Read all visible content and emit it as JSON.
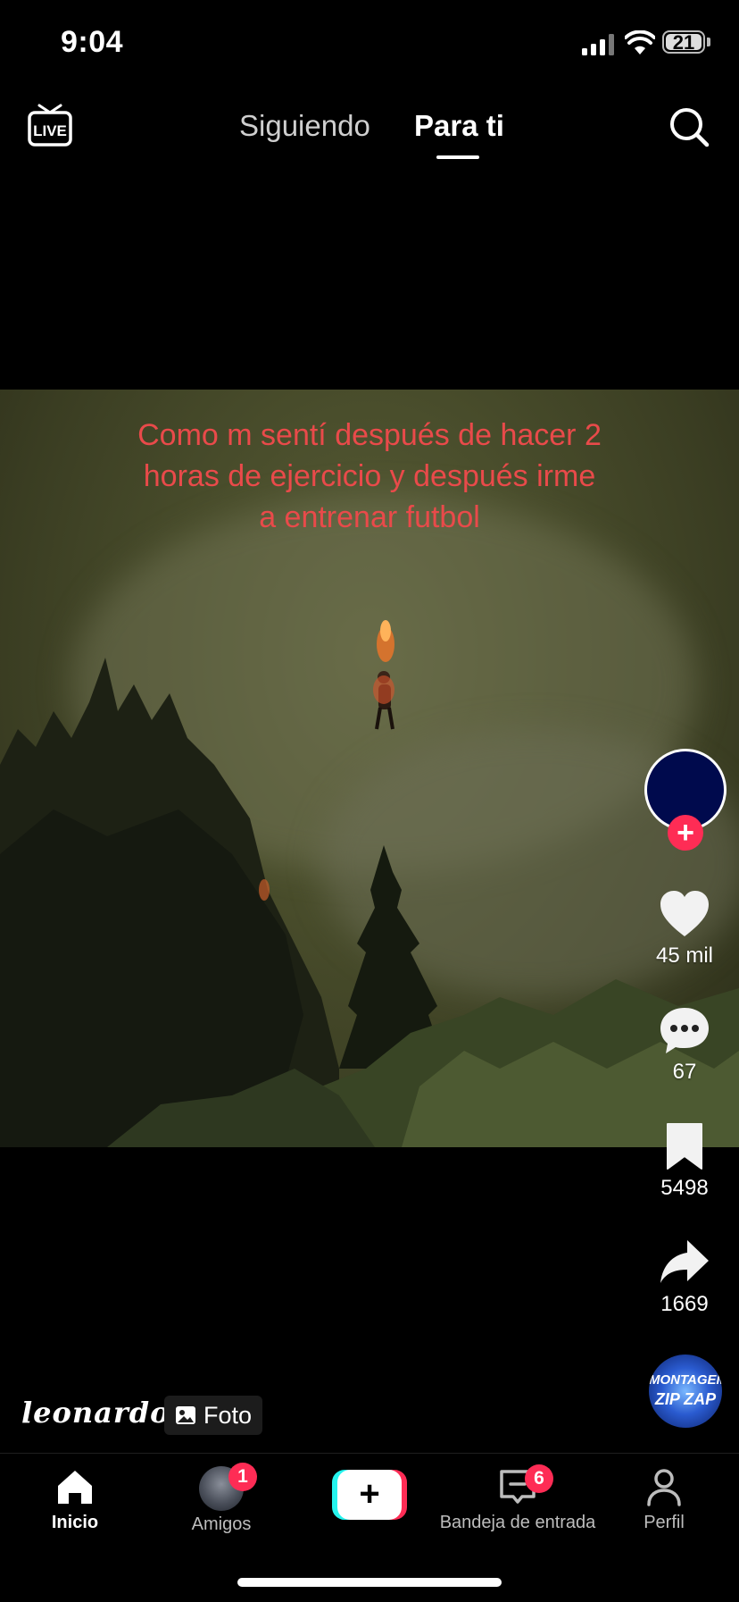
{
  "status_bar": {
    "time": "9:04",
    "battery": "21"
  },
  "top_nav": {
    "live_label": "LIVE",
    "tabs": [
      {
        "label": "Siguiendo",
        "active": false
      },
      {
        "label": "Para ti",
        "active": true
      }
    ]
  },
  "video": {
    "caption": "Como m sentí después de hacer 2 horas de ejercicio y después irme a entrenar futbol"
  },
  "right_rail": {
    "likes": "45 mil",
    "comments": "67",
    "bookmarks": "5498",
    "shares": "1669",
    "music_disc_text": [
      "MONTAGEM",
      "ZIP ZAP"
    ]
  },
  "post": {
    "username": "leonardo",
    "type_label": "Foto"
  },
  "bottom_nav": {
    "items": [
      {
        "label": "Inicio",
        "icon": "home-icon",
        "active": true
      },
      {
        "label": "Amigos",
        "badge": "1",
        "icon": "friends-avatar"
      },
      {
        "label": "",
        "icon": "create-icon"
      },
      {
        "label": "Bandeja de entrada",
        "badge": "6",
        "icon": "inbox-icon"
      },
      {
        "label": "Perfil",
        "icon": "profile-icon"
      }
    ]
  },
  "colors": {
    "accent_red": "#fe2c55",
    "accent_cyan": "#25f4ee",
    "caption_red": "#e94a4a"
  }
}
